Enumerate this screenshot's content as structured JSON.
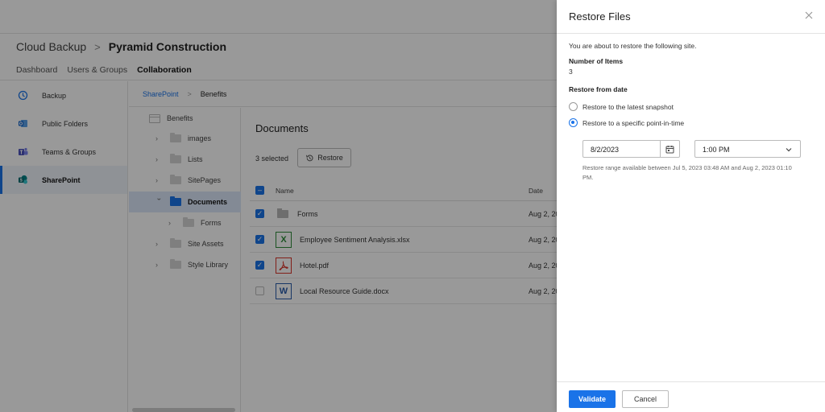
{
  "header": {
    "breadcrumb_root": "Cloud Backup",
    "breadcrumb_sep": ">",
    "breadcrumb_current": "Pyramid Construction",
    "tabs": [
      {
        "label": "Dashboard"
      },
      {
        "label": "Users & Groups"
      },
      {
        "label": "Collaboration"
      }
    ]
  },
  "sidebar": {
    "items": [
      {
        "label": "Backup",
        "icon": "history-icon"
      },
      {
        "label": "Public Folders",
        "icon": "outlook-icon"
      },
      {
        "label": "Teams & Groups",
        "icon": "teams-icon"
      },
      {
        "label": "SharePoint",
        "icon": "sharepoint-icon"
      }
    ]
  },
  "crumbbar": {
    "root": "SharePoint",
    "sep": ">",
    "current": "Benefits"
  },
  "tree": {
    "nodes": [
      {
        "label": "Benefits"
      },
      {
        "label": "images"
      },
      {
        "label": "Lists"
      },
      {
        "label": "SitePages"
      },
      {
        "label": "Documents"
      },
      {
        "label": "Forms"
      },
      {
        "label": "Site Assets"
      },
      {
        "label": "Style Library"
      }
    ]
  },
  "documents": {
    "title": "Documents",
    "selected_text": "3 selected",
    "restore_label": "Restore",
    "columns": {
      "name": "Name",
      "date": "Date"
    },
    "rows": [
      {
        "name": "Forms",
        "date": "Aug 2, 20",
        "type": "folder",
        "checked": true
      },
      {
        "name": "Employee Sentiment Analysis.xlsx",
        "date": "Aug 2, 20",
        "type": "xlsx",
        "checked": true
      },
      {
        "name": "Hotel.pdf",
        "date": "Aug 2, 20",
        "type": "pdf",
        "checked": true
      },
      {
        "name": "Local Resource Guide.docx",
        "date": "Aug 2, 20",
        "type": "docx",
        "checked": false
      }
    ]
  },
  "panel": {
    "title": "Restore Files",
    "intro": "You are about to restore the following site.",
    "items_label": "Number of Items",
    "items_value": "3",
    "from_date_label": "Restore from date",
    "option_latest": "Restore to the latest snapshot",
    "option_point": "Restore to a specific point-in-time",
    "selected_option": "point",
    "date_value": "8/2/2023",
    "time_value": "1:00 PM",
    "range_note": "Restore range available between Jul 5, 2023 03:48 AM and Aug 2, 2023 01:10 PM.",
    "validate_label": "Validate",
    "cancel_label": "Cancel"
  },
  "colors": {
    "accent": "#1a73e8",
    "overlay": "rgba(0,0,0,0.40)"
  }
}
